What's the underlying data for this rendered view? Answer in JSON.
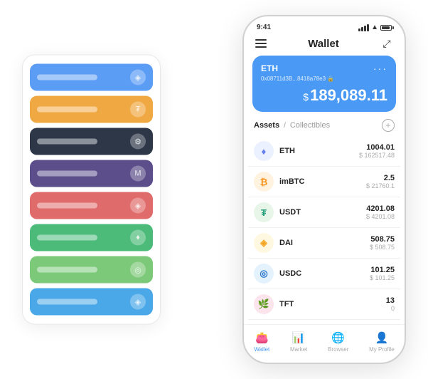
{
  "status": {
    "time": "9:41",
    "battery_label": "battery"
  },
  "header": {
    "title": "Wallet",
    "menu_label": "menu",
    "expand_label": "expand"
  },
  "eth_card": {
    "symbol": "ETH",
    "address": "0x08711d3B...8418a78e3",
    "address_emoji": "🔒",
    "balance_currency": "$",
    "balance": "189,089.11",
    "more_label": "more"
  },
  "assets": {
    "tab_active": "Assets",
    "tab_divider": "/",
    "tab_inactive": "Collectibles",
    "add_label": "add"
  },
  "asset_list": [
    {
      "symbol": "ETH",
      "logo_text": "♦",
      "logo_class": "logo-eth",
      "amount": "1004.01",
      "usd": "$ 162517.48"
    },
    {
      "symbol": "imBTC",
      "logo_text": "₿",
      "logo_class": "logo-imbtc",
      "amount": "2.5",
      "usd": "$ 21760.1"
    },
    {
      "symbol": "USDT",
      "logo_text": "₮",
      "logo_class": "logo-usdt",
      "amount": "4201.08",
      "usd": "$ 4201.08"
    },
    {
      "symbol": "DAI",
      "logo_text": "◈",
      "logo_class": "logo-dai",
      "amount": "508.75",
      "usd": "$ 508.75"
    },
    {
      "symbol": "USDC",
      "logo_text": "◎",
      "logo_class": "logo-usdc",
      "amount": "101.25",
      "usd": "$ 101.25"
    },
    {
      "symbol": "TFT",
      "logo_text": "🌿",
      "logo_class": "logo-tft",
      "amount": "13",
      "usd": "0"
    }
  ],
  "bottom_nav": [
    {
      "icon": "👛",
      "label": "Wallet",
      "active": true
    },
    {
      "icon": "📊",
      "label": "Market",
      "active": false
    },
    {
      "icon": "🌐",
      "label": "Browser",
      "active": false
    },
    {
      "icon": "👤",
      "label": "My Profile",
      "active": false
    }
  ],
  "card_stack": [
    {
      "color_class": "card-blue",
      "icon": "◈"
    },
    {
      "color_class": "card-orange",
      "icon": "₮"
    },
    {
      "color_class": "card-dark",
      "icon": "⚙"
    },
    {
      "color_class": "card-purple",
      "icon": "M"
    },
    {
      "color_class": "card-red",
      "icon": "◈"
    },
    {
      "color_class": "card-green",
      "icon": "♦"
    },
    {
      "color_class": "card-light-green",
      "icon": "◎"
    },
    {
      "color_class": "card-sky",
      "icon": "◈"
    }
  ]
}
